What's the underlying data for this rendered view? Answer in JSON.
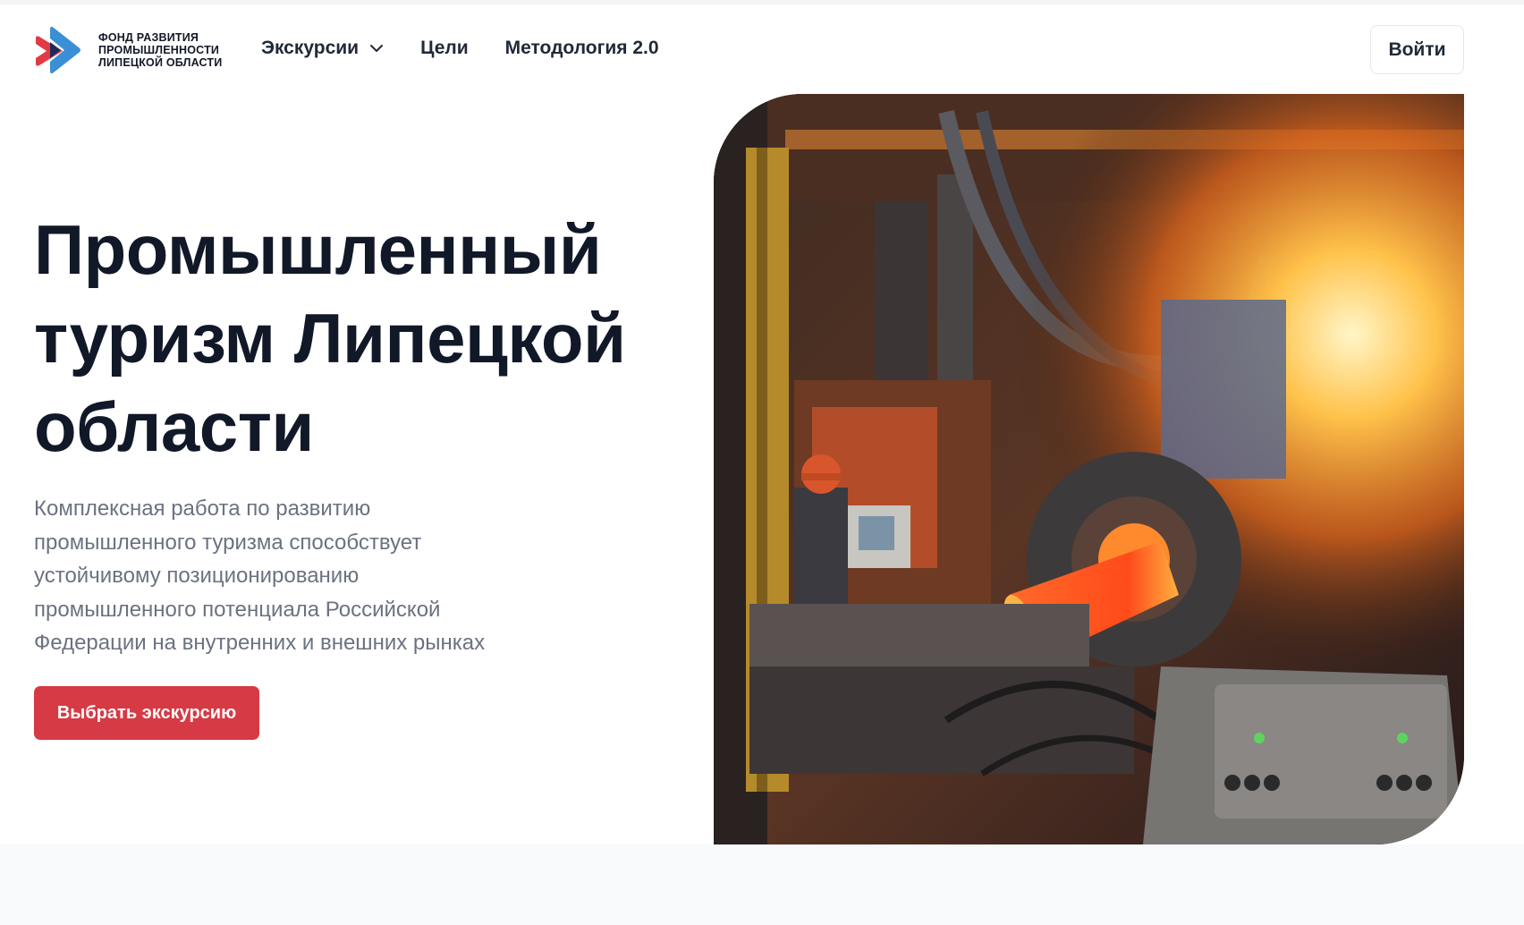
{
  "header": {
    "logo_lines": [
      "ФОНД РАЗВИТИЯ",
      "ПРОМЫШЛЕННОСТИ",
      "ЛИПЕЦКОЙ ОБЛАСТИ"
    ],
    "nav": [
      {
        "label": "Экскурсии",
        "icon": "chevron-down-icon"
      },
      {
        "label": "Цели"
      },
      {
        "label": "Методология 2.0"
      }
    ],
    "login_label": "Войти"
  },
  "hero": {
    "title_lines": [
      "Промышленный",
      "туризм Липецкой",
      "области"
    ],
    "description_lines": [
      "Комплексная работа по развитию",
      "промышленного туризма способствует",
      "устойчивому позиционированию",
      "промышленного потенциала Российской",
      "Федерации на внутренних и внешних рынках"
    ],
    "cta_label": "Выбрать экскурсию"
  },
  "colors": {
    "accent": "#d63a44",
    "logo_red": "#e23a45",
    "logo_blue": "#3b8fd6",
    "logo_navy": "#1f2a5a",
    "title": "#111827",
    "muted": "#6b7280"
  }
}
